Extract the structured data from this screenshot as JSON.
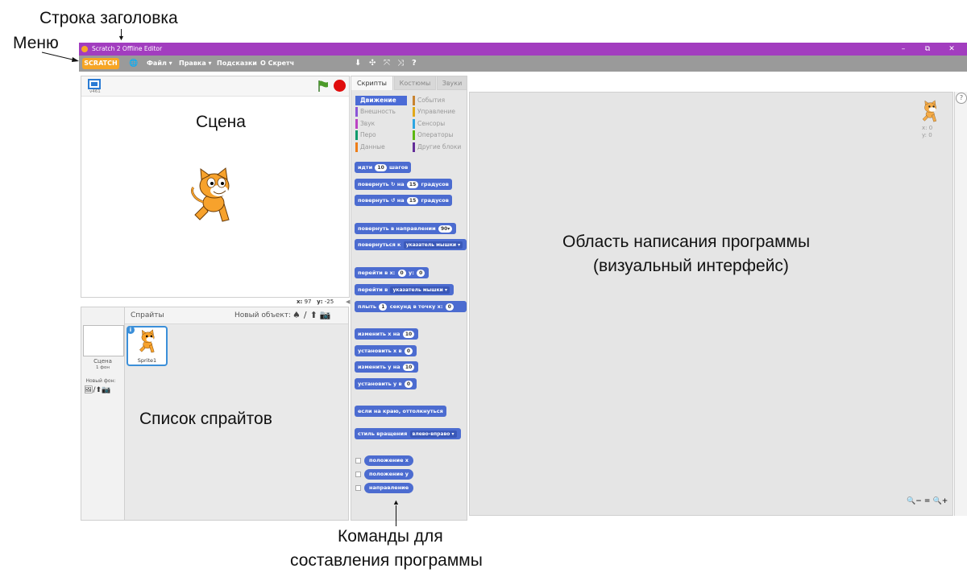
{
  "annotations": {
    "title_bar": "Строка заголовка",
    "menu": "Меню",
    "stage": "Сцена",
    "sprite_list": "Список спрайтов",
    "script_area_line1": "Область написания программы",
    "script_area_line2": "(визуальный интерфейс)",
    "commands_line1": "Команды для",
    "commands_line2": "составления программы"
  },
  "window": {
    "title": "Scratch 2 Offline Editor",
    "controls": {
      "minimize": "–",
      "restore": "⧉",
      "close": "✕"
    }
  },
  "menubar": {
    "logo": "SCRATCH",
    "globe_icon": "🌐",
    "items": [
      "Файл ▾",
      "Правка ▾",
      "Подсказки",
      "О Скретч"
    ],
    "tools": [
      "⬇",
      "✣",
      "⤧",
      "⤨",
      "?"
    ]
  },
  "stage": {
    "version": "v461",
    "mouse_x_label": "x:",
    "mouse_x": "97",
    "mouse_y_label": "y:",
    "mouse_y": "-25"
  },
  "sprites": {
    "header": "Спрайты",
    "new_object_label": "Новый объект:",
    "stage_label": "Сцена",
    "stage_backdrops": "1 фон",
    "new_backdrop_label": "Новый фон:",
    "items": [
      {
        "name": "Sprite1"
      }
    ]
  },
  "tabs": {
    "scripts": "Скрипты",
    "costumes": "Костюмы",
    "sounds": "Звуки"
  },
  "categories": {
    "left": [
      {
        "label": "Движение",
        "color": "#4a6cd4"
      },
      {
        "label": "Внешность",
        "color": "#8a55d7"
      },
      {
        "label": "Звук",
        "color": "#bb42c3"
      },
      {
        "label": "Перо",
        "color": "#0e9a6c"
      },
      {
        "label": "Данные",
        "color": "#ee7d16"
      }
    ],
    "right": [
      {
        "label": "События",
        "color": "#c88330"
      },
      {
        "label": "Управление",
        "color": "#e1a91a"
      },
      {
        "label": "Сенсоры",
        "color": "#2ca5e2"
      },
      {
        "label": "Операторы",
        "color": "#5cb712"
      },
      {
        "label": "Другие блоки",
        "color": "#632d99"
      }
    ]
  },
  "blocks": {
    "move": {
      "a": "идти",
      "v": "10",
      "b": "шагов"
    },
    "turn_right": {
      "a": "повернуть",
      "icon": "↻",
      "m": "на",
      "v": "15",
      "b": "градусов"
    },
    "turn_left": {
      "a": "повернуть",
      "icon": "↺",
      "m": "на",
      "v": "15",
      "b": "градусов"
    },
    "point_dir": {
      "a": "повернуть в направлении",
      "v": "90▾"
    },
    "point_to": {
      "a": "повернуться к",
      "v": "указатель мышки ▾"
    },
    "goto_xy": {
      "a": "перейти в x:",
      "v1": "0",
      "m": "y:",
      "v2": "0"
    },
    "goto": {
      "a": "перейти в",
      "v": "указатель мышки ▾"
    },
    "glide": {
      "a": "плыть",
      "v1": "1",
      "m": "секунд в точку x:",
      "v2": "0"
    },
    "change_x": {
      "a": "изменить х на",
      "v": "10"
    },
    "set_x": {
      "a": "установить х в",
      "v": "0"
    },
    "change_y": {
      "a": "изменить у на",
      "v": "10"
    },
    "set_y": {
      "a": "установить у в",
      "v": "0"
    },
    "bounce": {
      "a": "если на краю, оттолкнуться"
    },
    "rot_style": {
      "a": "стиль вращения",
      "v": "влево-вправо ▾"
    },
    "rep_x": "положение x",
    "rep_y": "положение y",
    "rep_dir": "направление"
  },
  "script_area": {
    "sprite_x": "x: 0",
    "sprite_y": "y: 0",
    "help": "?",
    "zoom": [
      "🔍−",
      "=",
      "🔍+"
    ]
  }
}
